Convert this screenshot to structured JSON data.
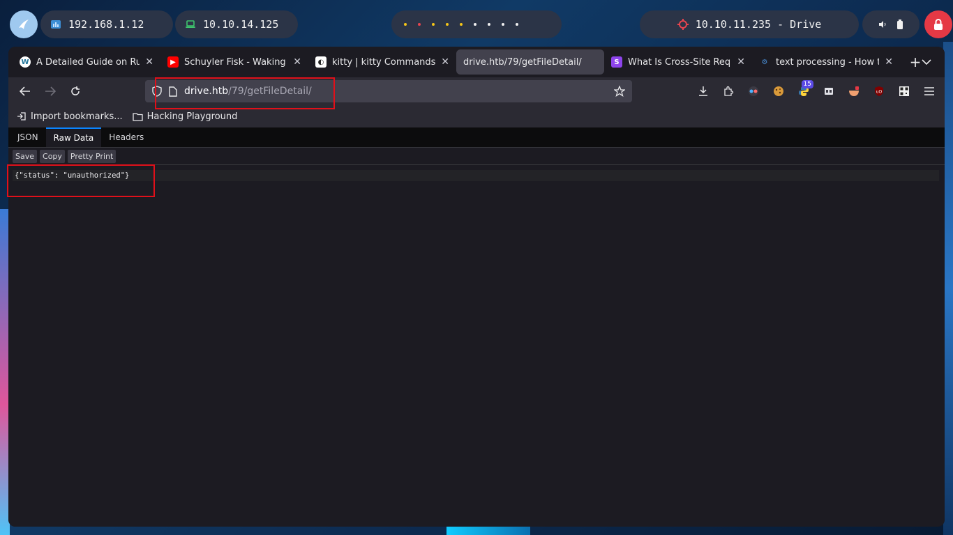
{
  "panel": {
    "local_ip": "192.168.1.12",
    "vpn_ip": "10.10.14.125",
    "target": "10.10.11.235 - Drive",
    "workspaces": [
      "yellow",
      "red",
      "yellow",
      "yellow",
      "yellow",
      "white",
      "white",
      "white",
      "white",
      "white"
    ]
  },
  "tabs": [
    {
      "label": "A Detailed Guide on Rub",
      "favicon": "wordpress-icon",
      "color": "#ffffff"
    },
    {
      "label": "Schuyler Fisk - Waking Li",
      "favicon": "youtube-icon",
      "color": "#ff0000"
    },
    {
      "label": "kitty | kitty Commands |",
      "favicon": "kitty-icon",
      "color": "#ffffff"
    },
    {
      "label": "drive.htb/79/getFileDetail/",
      "favicon": "",
      "color": "",
      "active": true
    },
    {
      "label": "What Is Cross-Site Requ",
      "favicon": "s-icon",
      "color": "#8e44ec"
    },
    {
      "label": "text processing - How to",
      "favicon": "stackexchange-icon",
      "color": "#4a90d9"
    }
  ],
  "url": {
    "host": "drive.htb",
    "path": "/79/getFileDetail/"
  },
  "toolbar": {
    "python_badge": "15"
  },
  "bookmarks": [
    {
      "label": "Import bookmarks..."
    },
    {
      "label": "Hacking Playground"
    }
  ],
  "viewer": {
    "tabs": [
      "JSON",
      "Raw Data",
      "Headers"
    ],
    "active_tab": "Raw Data",
    "buttons": [
      "Save",
      "Copy",
      "Pretty Print"
    ],
    "raw": "{\"status\": \"unauthorized\"}"
  },
  "colors": {
    "accent": "#0a84ff",
    "annotation": "#e0101a",
    "power": "#e53945"
  }
}
